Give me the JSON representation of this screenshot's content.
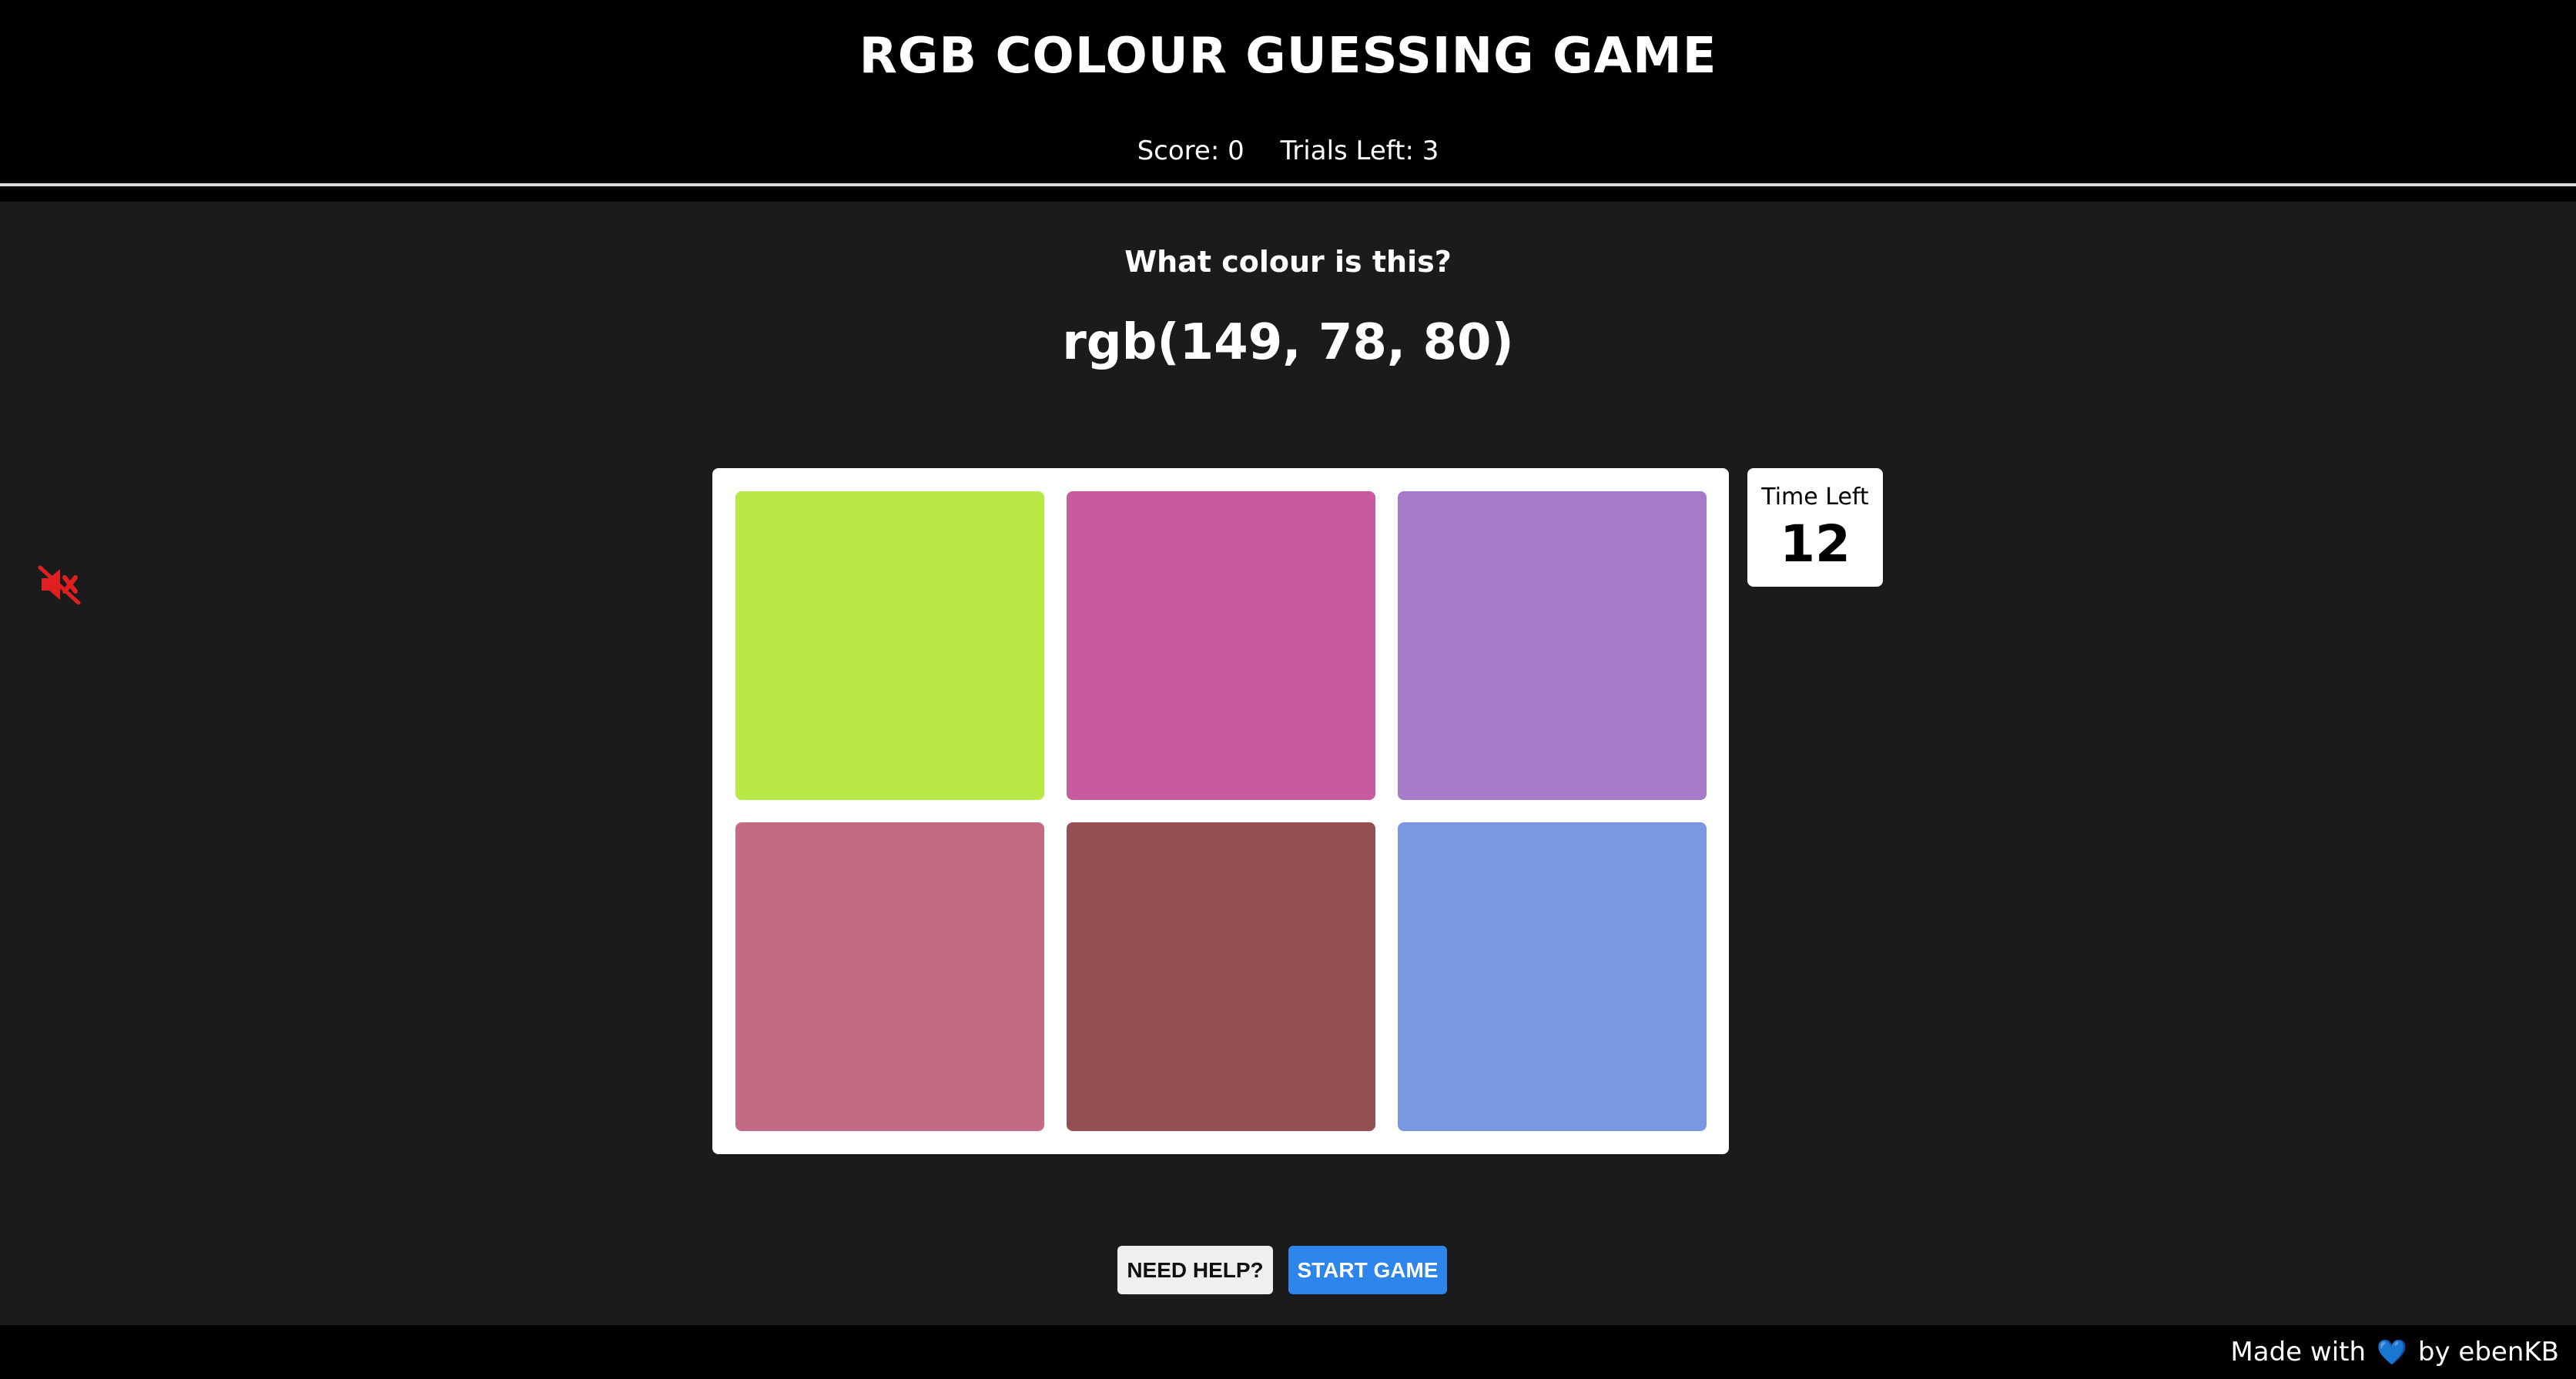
{
  "header": {
    "title": "RGB COLOUR GUESSING GAME",
    "score_label": "Score: 0",
    "trials_label": "Trials Left: 3"
  },
  "main": {
    "question": "What colour is this?",
    "target_rgb": "rgb(149, 78, 80)",
    "tiles": [
      {
        "color": "#b8e946"
      },
      {
        "color": "#c85a9e"
      },
      {
        "color": "#a57ac8"
      },
      {
        "color": "#c26b83"
      },
      {
        "color": "#954f52"
      },
      {
        "color": "#7899e0"
      }
    ],
    "timer": {
      "label": "Time Left",
      "value": "12"
    },
    "sound": {
      "icon": "muted-speaker-icon",
      "color": "#e02020"
    }
  },
  "buttons": {
    "help": "NEED HELP?",
    "start": "START GAME"
  },
  "footer": {
    "made_with": "Made with",
    "heart": "💙",
    "by": "by ebenKB"
  },
  "colors": {
    "header_bg": "#000000",
    "page_bg": "#1b1b1b",
    "start_button": "#2d84ea",
    "help_button": "#efefef"
  }
}
